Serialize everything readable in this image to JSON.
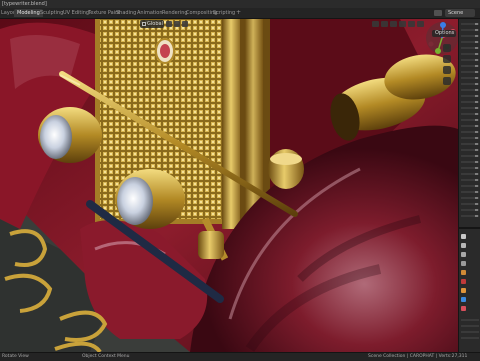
{
  "window": {
    "title": "[typewriter.blend]"
  },
  "workspace_tabs": [
    {
      "label": "Layout",
      "active": false
    },
    {
      "label": "Modeling",
      "active": true
    },
    {
      "label": "Sculpting",
      "active": false
    },
    {
      "label": "UV Editing",
      "active": false
    },
    {
      "label": "Texture Paint",
      "active": false
    },
    {
      "label": "Shading",
      "active": false
    },
    {
      "label": "Animation",
      "active": false
    },
    {
      "label": "Rendering",
      "active": false
    },
    {
      "label": "Compositing",
      "active": false
    },
    {
      "label": "Scripting",
      "active": false
    }
  ],
  "scene": {
    "label": "Scene"
  },
  "viewport": {
    "orientation": "Global",
    "options_label": "Options"
  },
  "statusbar": {
    "left": "Rotate View",
    "middle": "Object Context Menu",
    "right": "Scene Collection | CAROPHAT | Verts:27,311"
  },
  "colors": {
    "paint": "#7a1424",
    "brass": "#c9a23a",
    "ui_dark": "#2a2a2a",
    "gizmo_x": "#e0475a",
    "gizmo_y": "#78b22e",
    "gizmo_z": "#3b7ee8"
  }
}
